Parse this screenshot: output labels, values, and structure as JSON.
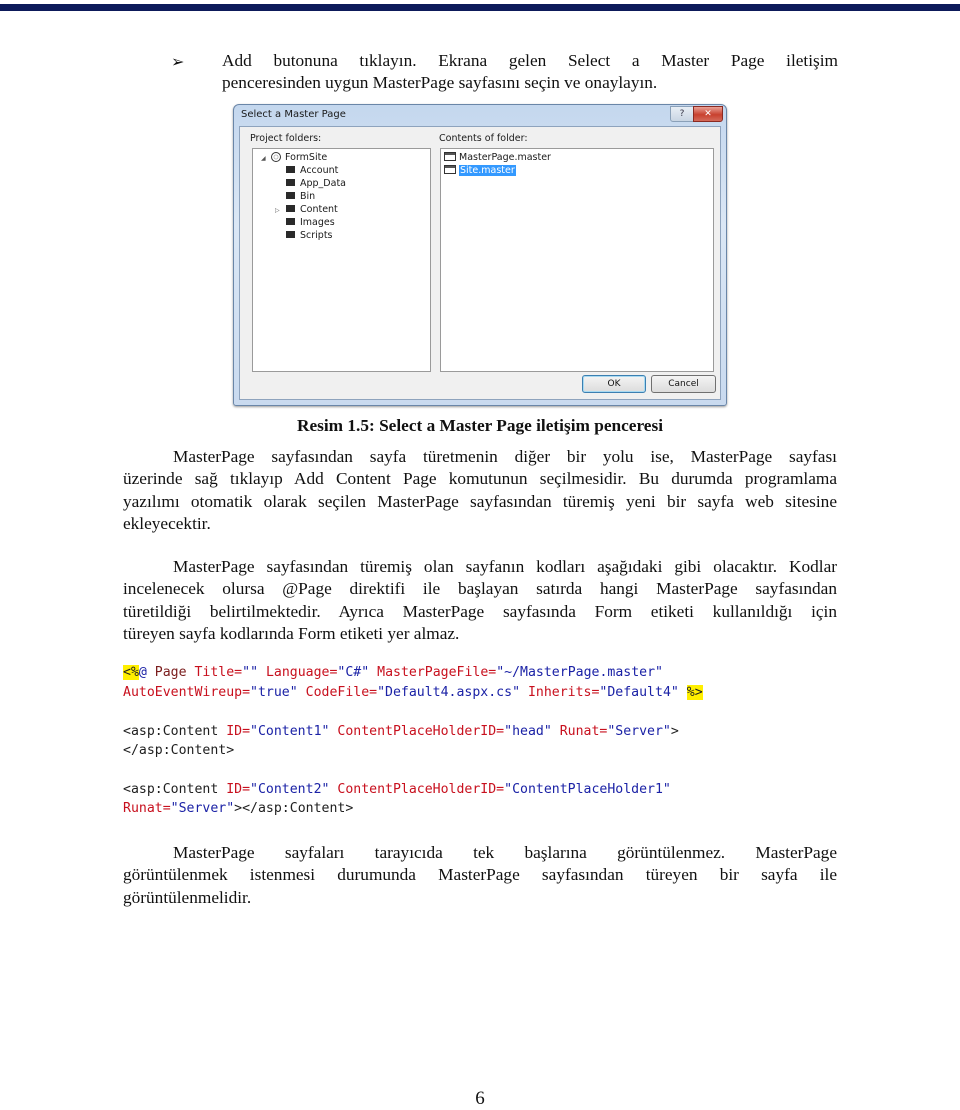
{
  "colors": {
    "top_bar": "#0d1a5a",
    "code_attr": "#c8101e",
    "code_value": "#1b22a6",
    "code_highlight": "#ffef00",
    "selection": "#3399ff"
  },
  "bullet": {
    "icon": "arrowhead-bullet-icon",
    "glyph": "➢",
    "text_line1": "Add butonuna tıklayın. Ekrana gelen Select a Master Page iletişim",
    "text_line2": "penceresinden uygun MasterPage sayfasını seçin ve onaylayın."
  },
  "dialog": {
    "title": "Select a Master Page",
    "help_glyph": "?",
    "close_glyph": "✕",
    "project_folders_label": "Project folders:",
    "contents_label": "Contents of folder:",
    "tree": {
      "root": "FormSite",
      "root_expander": "◢",
      "children": [
        "Account",
        "App_Data",
        "Bin",
        "Content",
        "Images",
        "Scripts"
      ],
      "collapsed_expander": "▷"
    },
    "files": [
      "MasterPage.master",
      "Site.master"
    ],
    "selected_file": "Site.master",
    "ok_label": "OK",
    "cancel_label": "Cancel"
  },
  "caption": "Resim 1.5: Select a Master Page iletişim penceresi",
  "paragraphs": {
    "p1": [
      "MasterPage sayfasından sayfa türetmenin diğer bir yolu ise, MasterPage sayfası",
      "üzerinde sağ tıklayıp Add Content Page komutunun seçilmesidir. Bu durumda programlama",
      "yazılımı otomatik olarak seçilen MasterPage sayfasından türemiş yeni bir sayfa web sitesine",
      "ekleyecektir."
    ],
    "p2": [
      "MasterPage sayfasından türemiş olan sayfanın kodları aşağıdaki gibi olacaktır. Kodlar",
      "incelenecek olursa @Page direktifi ile başlayan satırda hangi MasterPage sayfasından",
      "türetildiği belirtilmektedir. Ayrıca MasterPage sayfasında Form etiketi kullanıldığı için",
      "türeyen sayfa kodlarında Form etiketi yer almaz."
    ],
    "p3": [
      "MasterPage sayfaları tarayıcıda tek başlarına görüntülenmez. MasterPage",
      "görüntülenmek istenmesi durumunda MasterPage sayfasından türeyen bir sayfa ile",
      "görüntülenmelidir."
    ]
  },
  "code": {
    "l1": {
      "open": "<%",
      "at": "@",
      "page": " Page ",
      "a1": "Title=",
      "v1": "\"\"",
      "a2": " Language=",
      "v2": "\"C#\"",
      "a3": " MasterPageFile=",
      "v3": "\"~/MasterPage.master\""
    },
    "l2": {
      "a1": "AutoEventWireup=",
      "v1": "\"true\"",
      "a2": " CodeFile=",
      "v2": "\"Default4.aspx.cs\"",
      "a3": " Inherits=",
      "v3": "\"Default4\"",
      "close": "%>"
    },
    "l3": {
      "tag": "<asp:Content ",
      "a1": "ID=",
      "v1": "\"Content1\"",
      "a2": " ContentPlaceHolderID=",
      "v2": "\"head\"",
      "a3": " Runat=",
      "v3": "\"Server\"",
      "end": ">"
    },
    "l4": {
      "tag": "</asp:Content>"
    },
    "l5": {
      "tag": "<asp:Content ",
      "a1": "ID=",
      "v1": "\"Content2\"",
      "a2": " ContentPlaceHolderID=",
      "v2": "\"ContentPlaceHolder1\""
    },
    "l6": {
      "a1": "Runat=",
      "v1": "\"Server\"",
      "end": "></asp:Content>"
    }
  },
  "page_number": "6"
}
